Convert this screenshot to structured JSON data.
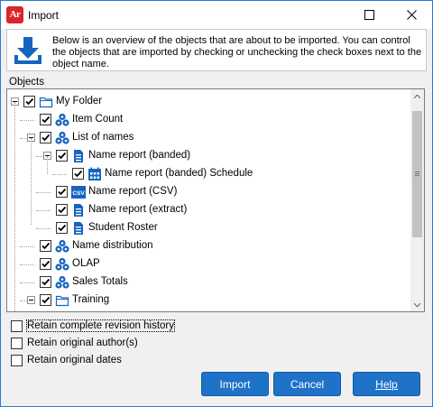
{
  "window": {
    "title": "Import",
    "app_icon_text": "Ar"
  },
  "info": {
    "text": "Below is an overview of the objects that are about to be imported.  You can control the objects that are imported by checking or unchecking the check boxes next to the object name.",
    "icon": "download-icon"
  },
  "objects_label": "Objects",
  "tree": {
    "items": [
      {
        "label": "My Folder",
        "icon": "folder-icon",
        "checked": true,
        "expandable": true
      },
      {
        "label": "Item Count",
        "icon": "cube-group-icon",
        "checked": true
      },
      {
        "label": "List of names",
        "icon": "cube-group-icon",
        "checked": true,
        "expandable": true
      },
      {
        "label": "Name report (banded)",
        "icon": "report-icon",
        "checked": true,
        "expandable": true
      },
      {
        "label": "Name report (banded) Schedule",
        "icon": "calendar-icon",
        "checked": true
      },
      {
        "label": "Name report (CSV)",
        "icon": "csv-icon",
        "checked": true
      },
      {
        "label": "Name report (extract)",
        "icon": "report-icon",
        "checked": true
      },
      {
        "label": "Student Roster",
        "icon": "report-icon",
        "checked": true
      },
      {
        "label": "Name distribution",
        "icon": "cube-group-icon",
        "checked": true
      },
      {
        "label": "OLAP",
        "icon": "cube-group-icon",
        "checked": true
      },
      {
        "label": "Sales Totals",
        "icon": "cube-group-icon",
        "checked": true
      },
      {
        "label": "Training",
        "icon": "folder-icon",
        "checked": true,
        "expandable": true
      }
    ],
    "csv_icon_text": "CSV"
  },
  "options": [
    {
      "label": "Retain complete revision history",
      "checked": false
    },
    {
      "label": "Retain original author(s)",
      "checked": false
    },
    {
      "label": "Retain original dates",
      "checked": false
    }
  ],
  "buttons": {
    "import": "Import",
    "cancel": "Cancel",
    "help": "Help"
  },
  "colors": {
    "accent": "#1e72c8",
    "icon_blue": "#1565c0",
    "app_icon_red": "#d9262b"
  }
}
